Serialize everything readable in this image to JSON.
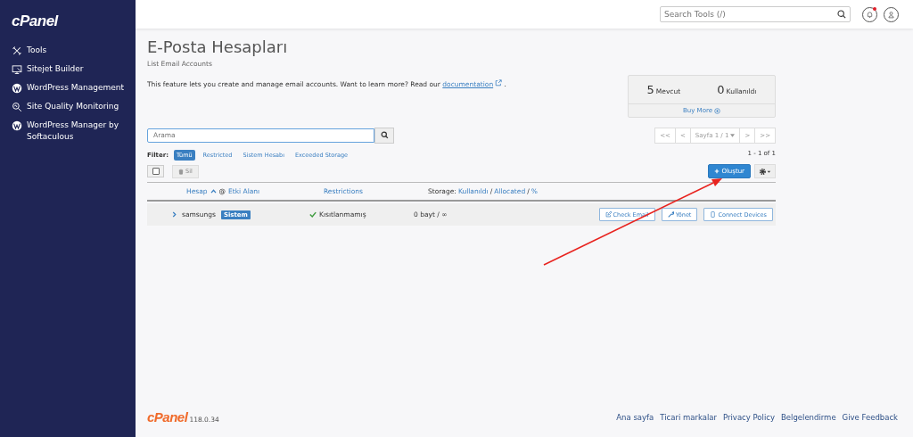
{
  "sidebar": {
    "logo": "cPanel",
    "items": [
      {
        "label": "Tools",
        "kind": "tools"
      },
      {
        "label": "Sitejet Builder",
        "kind": "builder"
      },
      {
        "label": "WordPress Management",
        "kind": "wordpress"
      },
      {
        "label": "Site Quality Monitoring",
        "kind": "monitoring"
      },
      {
        "label": "WordPress Manager by Softaculous",
        "kind": "wordpress"
      }
    ]
  },
  "topbar": {
    "search": {
      "placeholder": "Search Tools (/)"
    },
    "notification": {
      "unread": true
    }
  },
  "page": {
    "title": "E-Posta Hesapları",
    "subtitle": "List Email Accounts",
    "description": "This feature lets you create and manage email accounts. Want to learn more? Read our",
    "link": "documentation",
    "end": "."
  },
  "stats": [
    {
      "value": "5",
      "label": "Mevcut"
    },
    {
      "value": "0",
      "label": "Kullanıldı"
    }
  ],
  "buy_more": "Buy More",
  "search": {
    "placeholder": "Arama"
  },
  "pagination": {
    "before": [
      "<<",
      "<"
    ],
    "page": "Sayfa 1 / 1",
    "after": [
      ">",
      ">>"
    ],
    "count": "1 - 1 of 1"
  },
  "filter": {
    "label": "Filter:",
    "options": [
      {
        "label": "Tümü",
        "selected": true
      },
      {
        "label": "Restricted",
        "selected": false
      },
      {
        "label": "Sistem Hesabı",
        "selected": false
      },
      {
        "label": "Exceeded Storage",
        "selected": false
      }
    ]
  },
  "toolbar": {
    "select_all": {
      "checked": false
    },
    "delete": "Sil",
    "create": "Oluştur"
  },
  "table": {
    "header": {
      "account": "Hesap",
      "at": "@",
      "domain": "Etki Alanı",
      "restrictions": "Restrictions",
      "storage_label": "Storage:",
      "storage": [
        {
          "text": "Kullanıldı",
          "kind": "link"
        },
        {
          "text": "/",
          "kind": "sep"
        },
        {
          "text": "Allocated",
          "kind": "link"
        },
        {
          "text": "/",
          "kind": "sep"
        },
        {
          "text": "%",
          "kind": "link"
        }
      ]
    },
    "rows": [
      {
        "expanded": false,
        "account": "samsungs",
        "badge": "Sistem",
        "restriction": "Kısıtlanmamış",
        "storage": "0 bayt / ∞",
        "actions": [
          {
            "label": "Check Email",
            "kind": "check"
          },
          {
            "label": "Yönet",
            "kind": "manage"
          },
          {
            "label": "Connect Devices",
            "kind": "devices"
          }
        ]
      }
    ]
  },
  "footer": {
    "logo": "cPanel",
    "version": "118.0.34",
    "links": [
      "Ana sayfa",
      "Ticari markalar",
      "Privacy Policy",
      "Belgelendirme",
      "Give Feedback"
    ]
  }
}
